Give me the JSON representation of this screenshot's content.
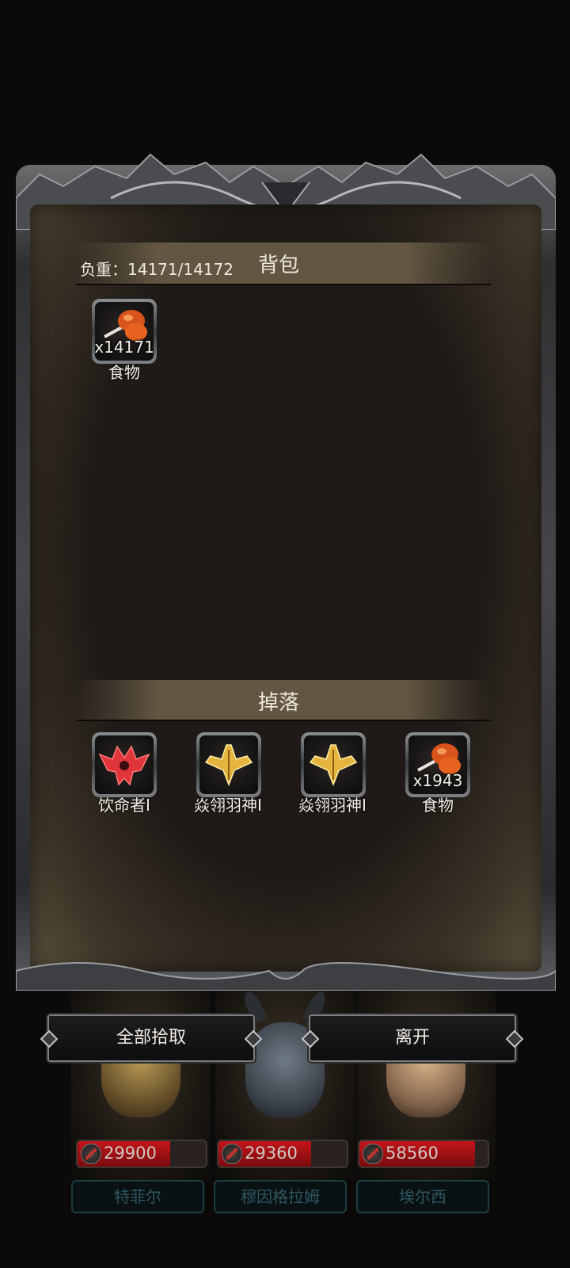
{
  "panel": {
    "load_label": "负重：14171/14172",
    "bag_title": "背包",
    "drop_title": "掉落"
  },
  "bag_items": [
    {
      "name": "食物",
      "qty": "x14171",
      "icon": "meat-icon"
    }
  ],
  "drop_items": [
    {
      "name": "饮命者Ⅰ",
      "qty": "",
      "icon": "red-demon-crest-icon"
    },
    {
      "name": "焱翎羽神Ⅰ",
      "qty": "",
      "icon": "golden-wings-crest-icon"
    },
    {
      "name": "焱翎羽神Ⅰ",
      "qty": "",
      "icon": "golden-wings-crest-icon"
    },
    {
      "name": "食物",
      "qty": "x1943",
      "icon": "meat-icon"
    }
  ],
  "buttons": {
    "pick_all": "全部拾取",
    "leave": "离开"
  },
  "heroes": [
    {
      "name": "特菲尔",
      "hp": "29900",
      "hp_fraction": 0.72
    },
    {
      "name": "穆因格拉姆",
      "hp": "29360",
      "hp_fraction": 0.72
    },
    {
      "name": "埃尔西",
      "hp": "58560",
      "hp_fraction": 0.9
    }
  ],
  "colors": {
    "hp_red": "#c2161a",
    "panel_bg": "#1f1a17",
    "header_band": "#6e6049",
    "name_teal": "#2c5660"
  }
}
